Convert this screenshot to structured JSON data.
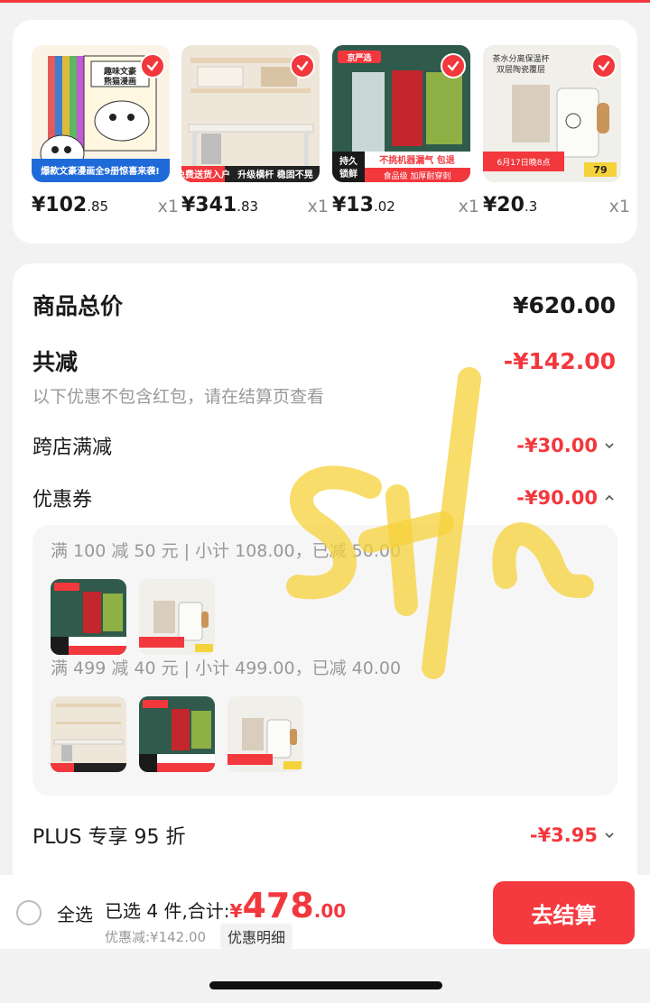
{
  "colors": {
    "accent": "#f2383d",
    "scribble": "#f5d23a"
  },
  "products": [
    {
      "price_int": "¥102",
      "price_dec": ".85",
      "qty": "x1",
      "thumb_text": "爆款文豪漫画全9册惊喜来袭!",
      "icon": "book-set-image"
    },
    {
      "price_int": "¥341",
      "price_dec": ".83",
      "qty": "x1",
      "thumb_text": "免费送货入户 升级横杆 稳固不晃",
      "icon": "desk-image"
    },
    {
      "price_int": "¥13",
      "price_dec": ".02",
      "qty": "x1",
      "thumb_text": "持久锁鲜 不挑机器漏气包退",
      "icon": "vacuum-bag-image"
    },
    {
      "price_int": "¥20",
      "price_dec": ".3",
      "qty": "x1",
      "thumb_text": "茶水分离保温杯 双层陶瓷覆层",
      "icon": "mug-image"
    }
  ],
  "summary": {
    "total_label": "商品总价",
    "total_value": "¥620.00",
    "reduce_label": "共减",
    "reduce_value": "-¥142.00",
    "note": "以下优惠不包含红包，请在结算页查看",
    "cross_store_label": "跨店满减",
    "cross_store_value": "-¥30.00",
    "coupon_label": "优惠券",
    "coupon_value": "-¥90.00",
    "coupon_rule_1": "满 100 减 50 元 | 小计 108.00，已减 50.00",
    "coupon_rule_2": "满 499 减 40 元 | 小计 499.00，已减 40.00",
    "plus_label": "PLUS 专享 95 折",
    "plus_value": "-¥3.95"
  },
  "bottombar": {
    "select_all": "全选",
    "selected_count": "已选 4 件,合计:",
    "yen": "¥",
    "total_int": "478",
    "total_dec": ".00",
    "discount_text": "优惠减:¥142.00",
    "detail_button": "优惠明细",
    "checkout_button": "去结算"
  }
}
